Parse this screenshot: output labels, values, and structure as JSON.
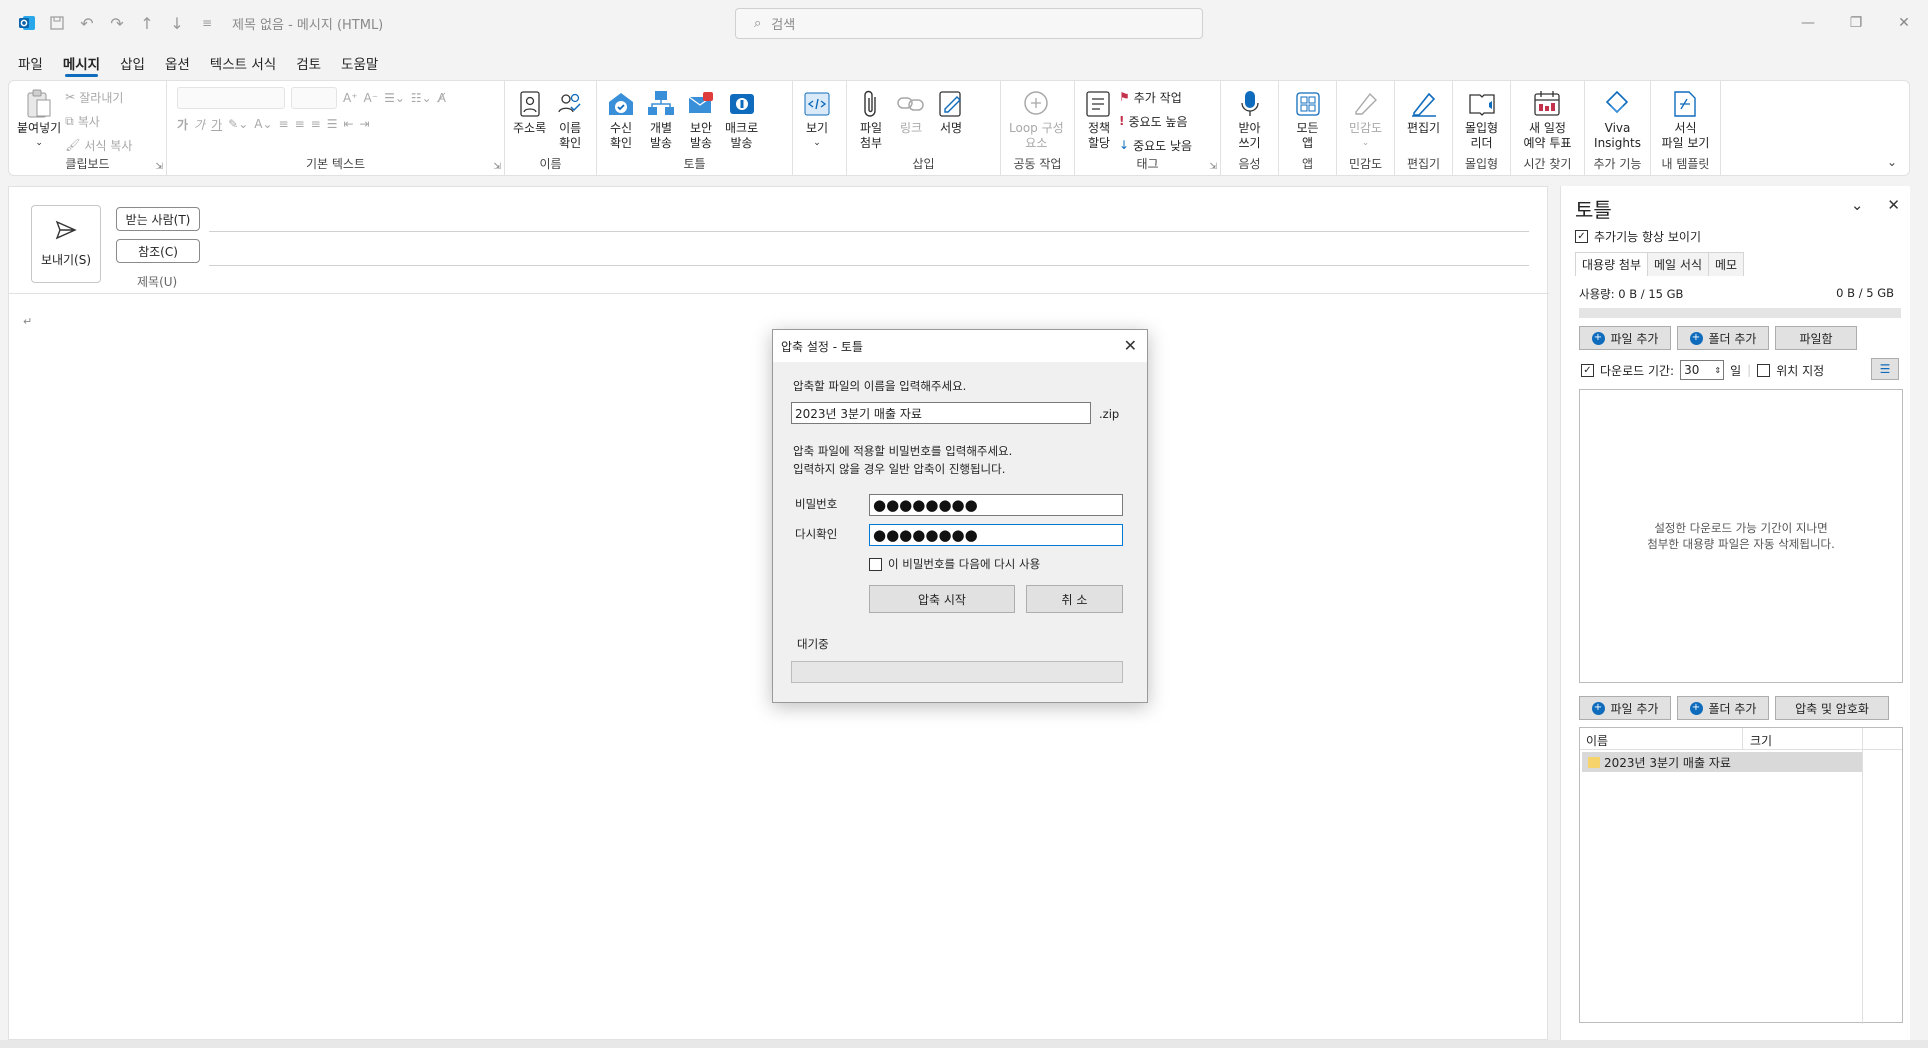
{
  "window": {
    "title": "제목 없음  -  메시지 (HTML)",
    "search_placeholder": "검색"
  },
  "menu": [
    "파일",
    "메시지",
    "삽입",
    "옵션",
    "텍스트 서식",
    "검토",
    "도움말"
  ],
  "ribbon": {
    "clipboard": {
      "paste": "붙여넣기",
      "cut": "잘라내기",
      "copy": "복사",
      "format_painter": "서식 복사",
      "label": "클립보드"
    },
    "basic_text": {
      "label": "기본 텍스트",
      "bold": "가",
      "italic": "가",
      "underline": "가"
    },
    "names": {
      "address_book": "주소록",
      "check_names": "이름\n확인",
      "label": "이름"
    },
    "totl": {
      "read_receipt": "수신\n확인",
      "individual_send": "개별\n발송",
      "secure_send": "보안\n발송",
      "macro_send": "매크로\n발송",
      "label": "토틀"
    },
    "view": {
      "label": "보기"
    },
    "insert": {
      "attach_file": "파일\n첨부",
      "link": "링크",
      "signature": "서명",
      "label": "삽입"
    },
    "collab": {
      "loop": "Loop 구성\n요소",
      "label": "공동 작업"
    },
    "tags": {
      "policy": "정책\n할당",
      "followup": "추가 작업",
      "high": "중요도 높음",
      "low": "중요도 낮음",
      "label": "태그"
    },
    "voice": {
      "dictate": "받아\n쓰기",
      "label": "음성"
    },
    "apps": {
      "all_apps": "모든\n앱",
      "label": "앱"
    },
    "sensitivity": {
      "btn": "민감도",
      "label": "민감도"
    },
    "editor": {
      "btn": "편집기",
      "label": "편집기"
    },
    "immersive": {
      "btn": "몰입형\n리더",
      "label": "몰입형"
    },
    "scheduling": {
      "btn": "새 일정\n예약 투표",
      "label": "시간 찾기"
    },
    "addins": {
      "btn": "Viva\nInsights",
      "label": "추가 기능"
    },
    "templates": {
      "btn": "서식\n파일 보기",
      "label": "내 템플릿"
    }
  },
  "compose": {
    "send": "보내기(S)",
    "to": "받는 사람(T)",
    "cc": "참조(C)",
    "subject": "제목(U)",
    "para_mark": "↵"
  },
  "dialog": {
    "title": "압축 설정 - 토틀",
    "prompt_name": "압축할 파일의 이름을 입력해주세요.",
    "filename": "2023년 3분기 매출 자료",
    "ext": ".zip",
    "prompt_pw_1": "압축 파일에 적용할 비밀번호를 입력해주세요.",
    "prompt_pw_2": "입력하지 않을 경우 일반 압축이 진행됩니다.",
    "pw_label": "비밀번호",
    "pw_value": "●●●●●●●●",
    "confirm_label": "다시확인",
    "confirm_value": "●●●●●●●●",
    "reuse_label": "이 비밀번호를 다음에 다시 사용",
    "start_btn": "압축 시작",
    "cancel_btn": "취 소",
    "status": "대기중",
    "progress": 0
  },
  "pane": {
    "title": "토틀",
    "always_show": "추가기능 항상 보이기",
    "tabs": [
      "대용량 첨부",
      "메일 서식",
      "메모"
    ],
    "usage_label": "사용량: 0 B / 15 GB",
    "usage_right": "0 B / 5 GB",
    "add_file": "파일 추가",
    "add_folder": "폴더 추가",
    "file_box": "파일함",
    "download_period": "다운로드 기간:",
    "days_value": "30",
    "days_unit": "일",
    "location": "위치 지정",
    "notice_1": "설정한 다운로드 가능 기간이 지나면",
    "notice_2": "첨부한 대용량 파일은 자동 삭제됩니다.",
    "compress_encrypt": "압축 및 암호화",
    "col_name": "이름",
    "col_size": "크기",
    "file_item": "2023년 3분기 매출 자료"
  }
}
